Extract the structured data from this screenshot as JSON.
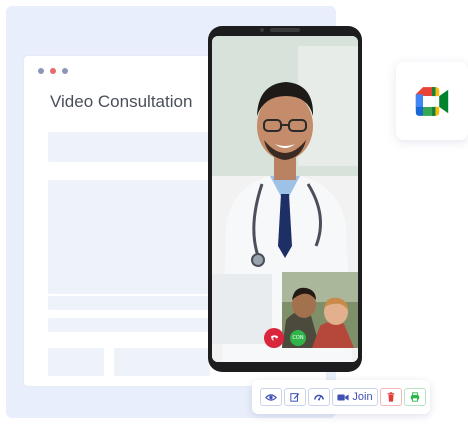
{
  "window": {
    "title": "Video Consultation",
    "dots": [
      "#8d96b8",
      "#e56a6a",
      "#8d96b8"
    ]
  },
  "call": {
    "accept_badge": "CON"
  },
  "toolbar": {
    "view_icon": "eye-icon",
    "edit_icon": "edit-icon",
    "dashboard_icon": "dashboard-icon",
    "join_label": "Join",
    "delete_icon": "trash-icon",
    "print_icon": "print-icon"
  },
  "colors": {
    "accent": "#3f51b5",
    "danger": "#e53935",
    "success": "#2fb54a",
    "background": "#e8eefb"
  }
}
